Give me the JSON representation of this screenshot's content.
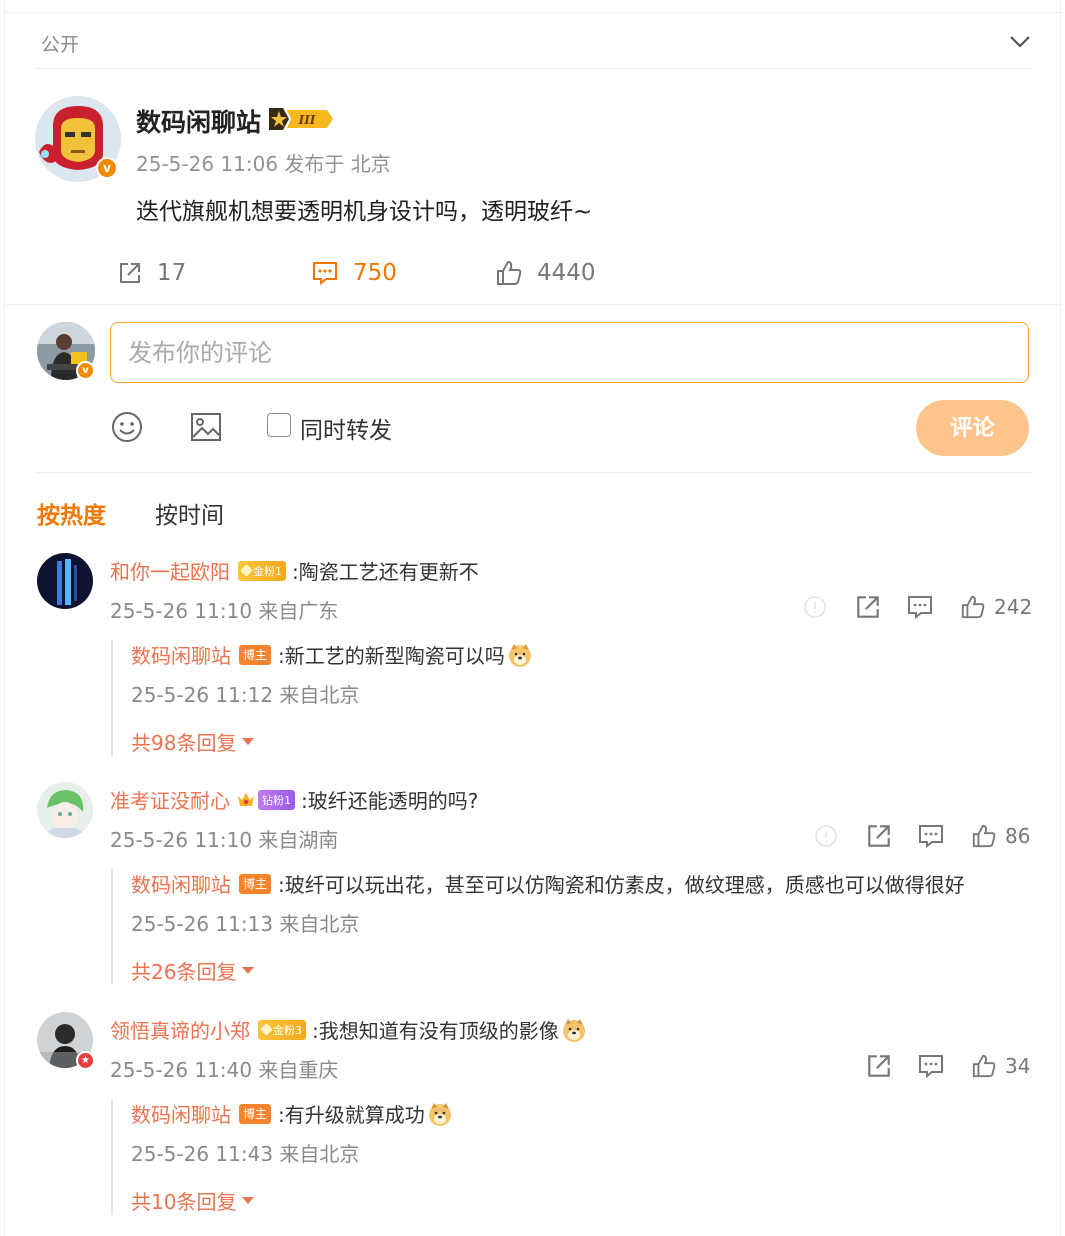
{
  "visibility": {
    "label": "公开"
  },
  "post": {
    "author": "数码闲聊站",
    "meta": "25-5-26 11:06 发布于 北京",
    "body": "迭代旗舰机想要透明机身设计吗，透明玻纤~",
    "reposts": "17",
    "comments": "750",
    "likes": "4440",
    "verified_mark": "v"
  },
  "composer": {
    "placeholder": "发布你的评论",
    "repost_label": "同时转发",
    "submit_label": "评论"
  },
  "sort_tabs": {
    "hot": "按热度",
    "time": "按时间"
  },
  "comments": [
    {
      "user": "和你一起欧阳",
      "fan_badge": "金粉1",
      "text": ":陶瓷工艺还有更新不",
      "meta": "25-5-26 11:10 来自广东",
      "likes": "242",
      "reply": {
        "user": "数码闲聊站",
        "owner_badge": "博主",
        "text": ":新工艺的新型陶瓷可以吗",
        "meta": "25-5-26 11:12 来自北京"
      },
      "more": "共98条回复"
    },
    {
      "user": "准考证没耐心",
      "fan_badge": "钻粉1",
      "text": ":玻纤还能透明的吗?",
      "meta": "25-5-26 11:10 来自湖南",
      "likes": "86",
      "reply": {
        "user": "数码闲聊站",
        "owner_badge": "博主",
        "text": ":玻纤可以玩出花，甚至可以仿陶瓷和仿素皮，做纹理感，质感也可以做得很好",
        "meta": "25-5-26 11:13 来自北京"
      },
      "more": "共26条回复"
    },
    {
      "user": "领悟真谛的小郑",
      "fan_badge": "金粉3",
      "text": ":我想知道有没有顶级的影像",
      "meta": "25-5-26 11:40 来自重庆",
      "likes": "34",
      "reply": {
        "user": "数码闲聊站",
        "owner_badge": "博主",
        "text": ":有升级就算成功",
        "meta": "25-5-26 11:43 来自北京"
      },
      "more": "共10条回复"
    }
  ],
  "colors": {
    "accent": "#f07800",
    "username": "#eb7350",
    "submit_disabled": "#fdc48c",
    "input_border": "#f3a735"
  }
}
